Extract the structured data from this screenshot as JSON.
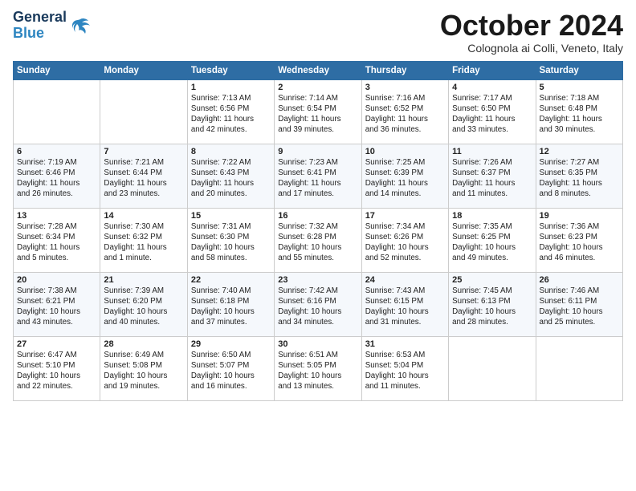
{
  "header": {
    "logo_line1": "General",
    "logo_line2": "Blue",
    "month_title": "October 2024",
    "location": "Colognola ai Colli, Veneto, Italy"
  },
  "weekdays": [
    "Sunday",
    "Monday",
    "Tuesday",
    "Wednesday",
    "Thursday",
    "Friday",
    "Saturday"
  ],
  "weeks": [
    [
      {
        "day": "",
        "info": ""
      },
      {
        "day": "",
        "info": ""
      },
      {
        "day": "1",
        "info": "Sunrise: 7:13 AM\nSunset: 6:56 PM\nDaylight: 11 hours\nand 42 minutes."
      },
      {
        "day": "2",
        "info": "Sunrise: 7:14 AM\nSunset: 6:54 PM\nDaylight: 11 hours\nand 39 minutes."
      },
      {
        "day": "3",
        "info": "Sunrise: 7:16 AM\nSunset: 6:52 PM\nDaylight: 11 hours\nand 36 minutes."
      },
      {
        "day": "4",
        "info": "Sunrise: 7:17 AM\nSunset: 6:50 PM\nDaylight: 11 hours\nand 33 minutes."
      },
      {
        "day": "5",
        "info": "Sunrise: 7:18 AM\nSunset: 6:48 PM\nDaylight: 11 hours\nand 30 minutes."
      }
    ],
    [
      {
        "day": "6",
        "info": "Sunrise: 7:19 AM\nSunset: 6:46 PM\nDaylight: 11 hours\nand 26 minutes."
      },
      {
        "day": "7",
        "info": "Sunrise: 7:21 AM\nSunset: 6:44 PM\nDaylight: 11 hours\nand 23 minutes."
      },
      {
        "day": "8",
        "info": "Sunrise: 7:22 AM\nSunset: 6:43 PM\nDaylight: 11 hours\nand 20 minutes."
      },
      {
        "day": "9",
        "info": "Sunrise: 7:23 AM\nSunset: 6:41 PM\nDaylight: 11 hours\nand 17 minutes."
      },
      {
        "day": "10",
        "info": "Sunrise: 7:25 AM\nSunset: 6:39 PM\nDaylight: 11 hours\nand 14 minutes."
      },
      {
        "day": "11",
        "info": "Sunrise: 7:26 AM\nSunset: 6:37 PM\nDaylight: 11 hours\nand 11 minutes."
      },
      {
        "day": "12",
        "info": "Sunrise: 7:27 AM\nSunset: 6:35 PM\nDaylight: 11 hours\nand 8 minutes."
      }
    ],
    [
      {
        "day": "13",
        "info": "Sunrise: 7:28 AM\nSunset: 6:34 PM\nDaylight: 11 hours\nand 5 minutes."
      },
      {
        "day": "14",
        "info": "Sunrise: 7:30 AM\nSunset: 6:32 PM\nDaylight: 11 hours\nand 1 minute."
      },
      {
        "day": "15",
        "info": "Sunrise: 7:31 AM\nSunset: 6:30 PM\nDaylight: 10 hours\nand 58 minutes."
      },
      {
        "day": "16",
        "info": "Sunrise: 7:32 AM\nSunset: 6:28 PM\nDaylight: 10 hours\nand 55 minutes."
      },
      {
        "day": "17",
        "info": "Sunrise: 7:34 AM\nSunset: 6:26 PM\nDaylight: 10 hours\nand 52 minutes."
      },
      {
        "day": "18",
        "info": "Sunrise: 7:35 AM\nSunset: 6:25 PM\nDaylight: 10 hours\nand 49 minutes."
      },
      {
        "day": "19",
        "info": "Sunrise: 7:36 AM\nSunset: 6:23 PM\nDaylight: 10 hours\nand 46 minutes."
      }
    ],
    [
      {
        "day": "20",
        "info": "Sunrise: 7:38 AM\nSunset: 6:21 PM\nDaylight: 10 hours\nand 43 minutes."
      },
      {
        "day": "21",
        "info": "Sunrise: 7:39 AM\nSunset: 6:20 PM\nDaylight: 10 hours\nand 40 minutes."
      },
      {
        "day": "22",
        "info": "Sunrise: 7:40 AM\nSunset: 6:18 PM\nDaylight: 10 hours\nand 37 minutes."
      },
      {
        "day": "23",
        "info": "Sunrise: 7:42 AM\nSunset: 6:16 PM\nDaylight: 10 hours\nand 34 minutes."
      },
      {
        "day": "24",
        "info": "Sunrise: 7:43 AM\nSunset: 6:15 PM\nDaylight: 10 hours\nand 31 minutes."
      },
      {
        "day": "25",
        "info": "Sunrise: 7:45 AM\nSunset: 6:13 PM\nDaylight: 10 hours\nand 28 minutes."
      },
      {
        "day": "26",
        "info": "Sunrise: 7:46 AM\nSunset: 6:11 PM\nDaylight: 10 hours\nand 25 minutes."
      }
    ],
    [
      {
        "day": "27",
        "info": "Sunrise: 6:47 AM\nSunset: 5:10 PM\nDaylight: 10 hours\nand 22 minutes."
      },
      {
        "day": "28",
        "info": "Sunrise: 6:49 AM\nSunset: 5:08 PM\nDaylight: 10 hours\nand 19 minutes."
      },
      {
        "day": "29",
        "info": "Sunrise: 6:50 AM\nSunset: 5:07 PM\nDaylight: 10 hours\nand 16 minutes."
      },
      {
        "day": "30",
        "info": "Sunrise: 6:51 AM\nSunset: 5:05 PM\nDaylight: 10 hours\nand 13 minutes."
      },
      {
        "day": "31",
        "info": "Sunrise: 6:53 AM\nSunset: 5:04 PM\nDaylight: 10 hours\nand 11 minutes."
      },
      {
        "day": "",
        "info": ""
      },
      {
        "day": "",
        "info": ""
      }
    ]
  ]
}
